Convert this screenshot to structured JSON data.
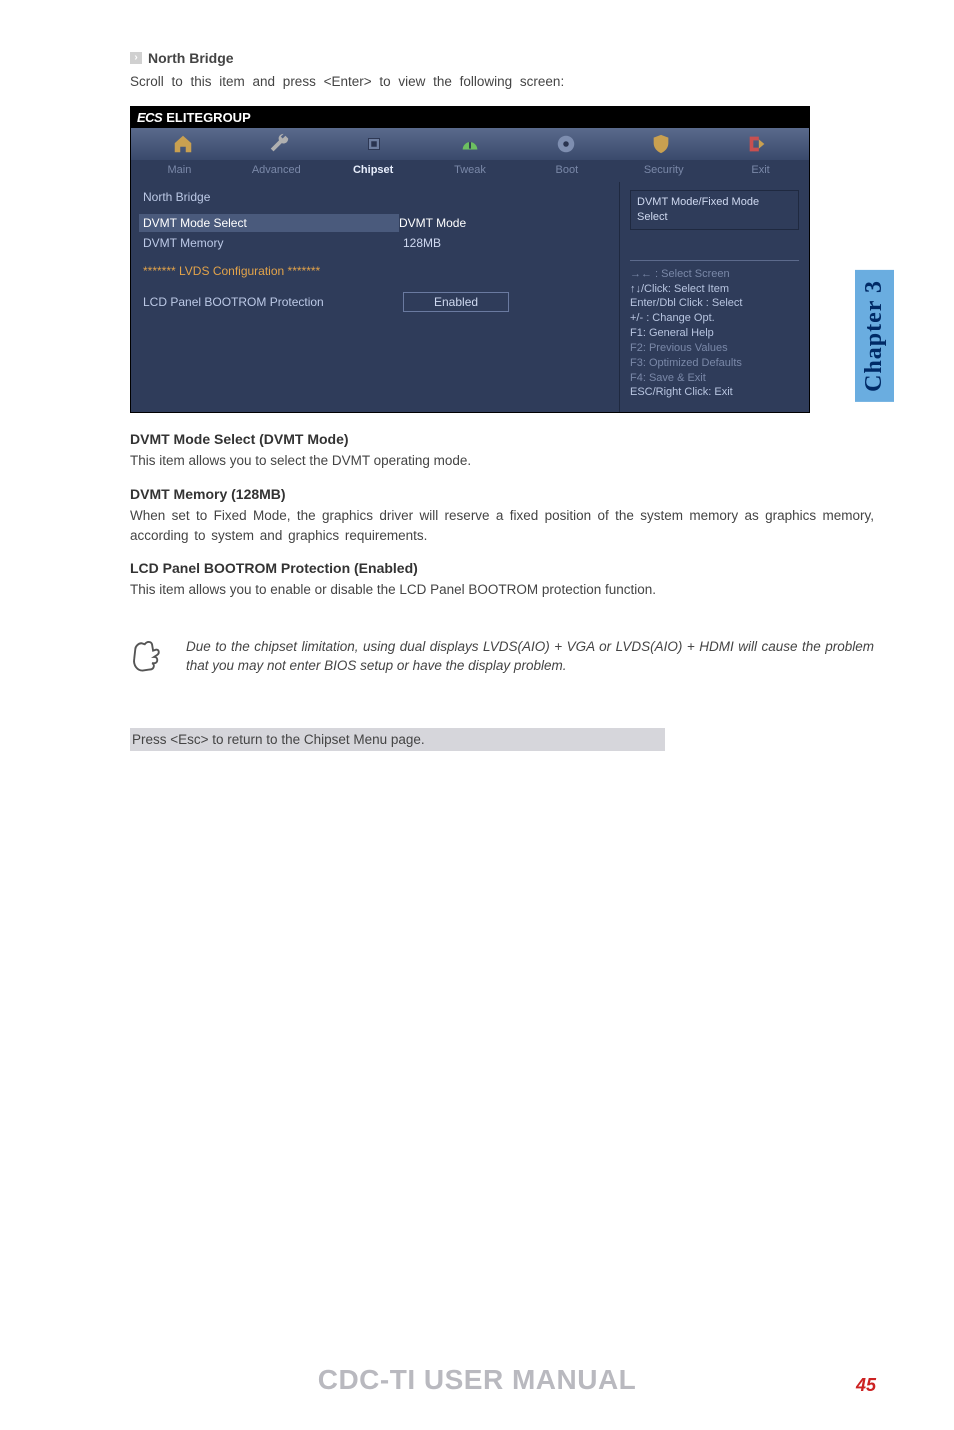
{
  "section": {
    "title": "North Bridge",
    "intro": "Scroll to this item and press <Enter> to view the following screen:"
  },
  "bios": {
    "brand_prefix": "ECS",
    "brand": "ELITEGROUP",
    "icons": [
      "home-icon",
      "wrench-icon",
      "chip-icon",
      "gauge-icon",
      "disc-icon",
      "shield-icon",
      "exit-icon"
    ],
    "tabs": [
      "Main",
      "Advanced",
      "Chipset",
      "Tweak",
      "Boot",
      "Security",
      "Exit"
    ],
    "active_tab": "Chipset",
    "heading": "North Bridge",
    "rows": {
      "dvmt_mode_select": {
        "label": "DVMT Mode Select",
        "value": "DVMT Mode"
      },
      "dvmt_memory": {
        "label": "DVMT Memory",
        "value": "128MB"
      },
      "lvds_header": "*******  LVDS Configuration  *******",
      "lcd_bootrom": {
        "label": "LCD Panel BOOTROM Protection",
        "value": "Enabled"
      }
    },
    "right": {
      "desc1": "DVMT Mode/Fixed Mode",
      "desc2": "Select",
      "keys": [
        "→← : Select Screen",
        "↑↓/Click: Select Item",
        "Enter/Dbl Click : Select",
        "+/- : Change Opt.",
        "F1: General Help",
        "F2: Previous Values",
        "F3: Optimized Defaults",
        "F4: Save & Exit",
        "ESC/Right Click: Exit"
      ]
    }
  },
  "sections": {
    "dvmt_mode": {
      "head": "DVMT Mode Select (DVMT Mode)",
      "body": "This item allows you to select the DVMT operating mode."
    },
    "dvmt_mem": {
      "head": "DVMT Memory (128MB)",
      "body": "When set to Fixed Mode, the graphics driver will reserve a fixed position of the system memory as graphics memory, according to system and graphics requirements."
    },
    "lcd": {
      "head": "LCD Panel BOOTROM Protection (Enabled)",
      "body": "This item allows you to enable or disable the LCD Panel BOOTROM protection function."
    }
  },
  "note": "Due to the chipset limitation, using dual displays LVDS(AIO) + VGA or LVDS(AIO) + HDMI will cause the problem that you may not enter BIOS setup or have the display problem.",
  "escline": "Press <Esc> to return to the Chipset Menu page.",
  "chapter": "Chapter 3",
  "footer": "CDC-TI USER MANUAL",
  "pagenum": "45"
}
